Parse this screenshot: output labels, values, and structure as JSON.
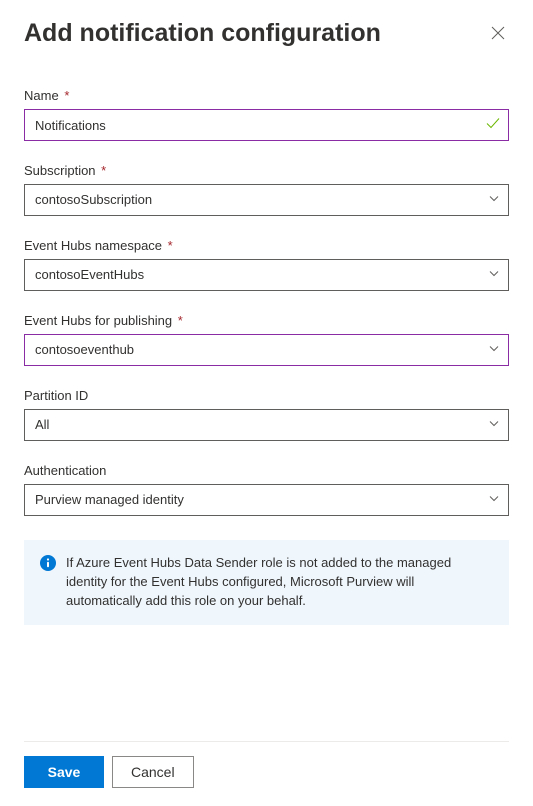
{
  "header": {
    "title": "Add notification configuration"
  },
  "fields": {
    "name": {
      "label": "Name",
      "required": true,
      "value": "Notifications"
    },
    "subscription": {
      "label": "Subscription",
      "required": true,
      "value": "contosoSubscription"
    },
    "namespace": {
      "label": "Event Hubs namespace",
      "required": true,
      "value": "contosoEventHubs"
    },
    "publishing": {
      "label": "Event Hubs for publishing",
      "required": true,
      "value": "contosoeventhub"
    },
    "partition": {
      "label": "Partition ID",
      "required": false,
      "value": "All"
    },
    "auth": {
      "label": "Authentication",
      "required": false,
      "value": "Purview managed identity"
    }
  },
  "info": {
    "message": "If Azure Event Hubs Data Sender role is not added to the managed identity for the Event Hubs configured, Microsoft Purview will automatically add this role on your behalf."
  },
  "footer": {
    "save": "Save",
    "cancel": "Cancel"
  },
  "required_marker": "*"
}
